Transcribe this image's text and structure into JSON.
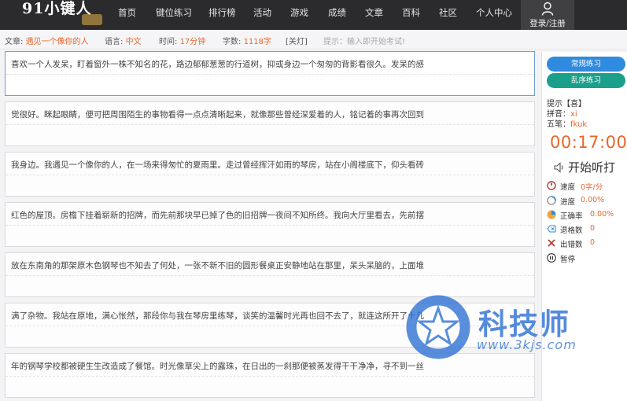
{
  "nav": {
    "logo": "91小键人",
    "items": [
      "首页",
      "键位练习",
      "排行榜",
      "活动",
      "游戏",
      "成绩",
      "文章",
      "百科",
      "社区",
      "个人中心"
    ],
    "login_label": "登录/注册"
  },
  "info": {
    "article_label": "文章:",
    "article_value": "遇见一个像你的人",
    "language_label": "语言:",
    "language_value": "中文",
    "time_label": "时间:",
    "time_value": "17分钟",
    "chars_label": "字数:",
    "chars_value": "1118字",
    "lamp": "[关灯]",
    "prompt": "提示：输入即开始考试!"
  },
  "lines": [
    "喜欢一个人发呆，盯着窗外一株不知名的花，路边郁郁葱葱的行道树，抑或身边一个匆匆的背影看很久。发呆的感",
    "觉很好。眯起眼睛，便可把周围陌生的事物看得一点点清晰起来，就像那些曾经深爱着的人，铭记着的事再次回到",
    "我身边。我遇见一个像你的人，在一场来得匆忙的夏雨里。走过曾经挥汗如雨的琴房，站在小阁楼底下，仰头看砖",
    "红色的屋顶。房檐下挂着崭新的招牌，而先前那块早已掉了色的旧招牌一夜间不知所终。我向大厅里看去，先前摆",
    "放在东南角的那架原木色钢琴也不知去了何处，一张不新不旧的圆形餐桌正安静地站在那里，呆头呆脑的，上面堆",
    "满了杂物。我站在原地，满心怅然，那段你与我在琴房里练琴，谈笑的温馨时光再也回不去了，就连这所开了十几",
    "年的钢琴学校都被硬生生改造成了餐馆。时光像草尖上的露珠，在日出的一刹那便被蒸发得干干净净，寻不到一丝"
  ],
  "sidebar": {
    "btn_normal": "常规练习",
    "btn_random": "乱序练习",
    "hint_title": "提示【喜】",
    "pinyin_label": "拼音：",
    "pinyin_value": "xi",
    "wubi_label": "五笔：",
    "wubi_value": "fkuk",
    "timer": "00:17:00",
    "listen_label": "开始听打",
    "stats": [
      {
        "icon": "speed-gauge-icon",
        "label": "速度",
        "value": "0字/分"
      },
      {
        "icon": "progress-icon",
        "label": "进度",
        "value": "0.00%"
      },
      {
        "icon": "accuracy-pie-icon",
        "label": "正确率",
        "value": "0.00%"
      },
      {
        "icon": "backspace-icon",
        "label": "退格数",
        "value": "0"
      },
      {
        "icon": "error-count-icon",
        "label": "出错数",
        "value": "0"
      }
    ],
    "pause_label": "暂停"
  },
  "watermark": {
    "name": "科技师",
    "url": "www.3kjs.com"
  },
  "colors": {
    "accent_orange": "#e8662a",
    "nav_bg": "#2b2b2d",
    "btn_blue": "#2f8be0",
    "btn_teal": "#1aa08a",
    "watermark_blue": "#2c6fd4"
  }
}
